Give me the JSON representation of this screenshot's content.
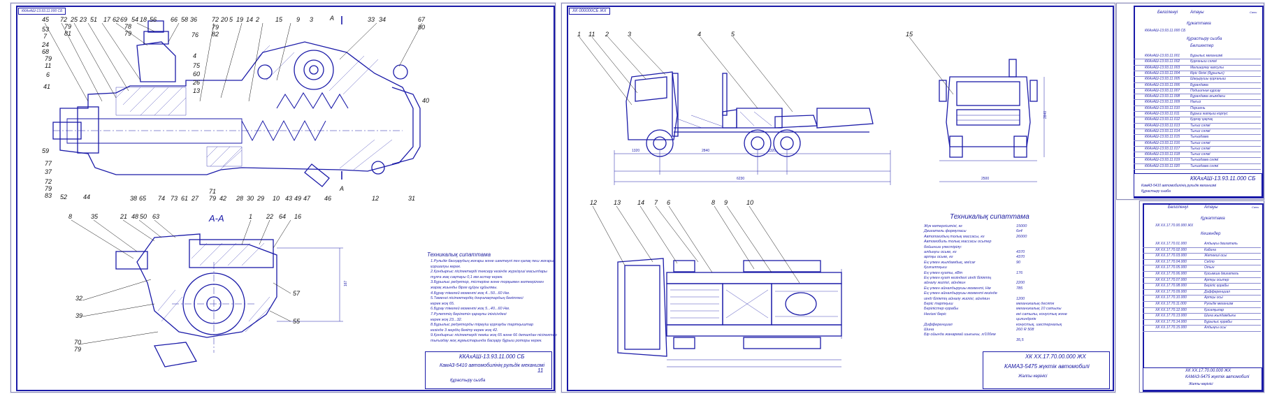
{
  "sheet1": {
    "tag": "ККАхАШ-13.93.11.000 СБ",
    "section_label": "А-А",
    "section_mark": "А",
    "callouts_top": [
      "45",
      "72",
      "25",
      "23",
      "51",
      "17",
      "62",
      "69",
      "54",
      "18",
      "56",
      "66",
      "58",
      "36",
      "72",
      "20",
      "5",
      "19",
      "14",
      "2",
      "15",
      "9",
      "3",
      "33",
      "34",
      "67",
      "80"
    ],
    "callouts_left": [
      "53",
      "7",
      "24",
      "68",
      "79",
      "11",
      "6",
      "41",
      "59",
      "77",
      "37",
      "72",
      "79",
      "83",
      "52",
      "44"
    ],
    "callouts_bottom": [
      "38",
      "65",
      "74",
      "73",
      "61",
      "27",
      "71",
      "79",
      "42",
      "28",
      "30",
      "29",
      "10",
      "43",
      "49",
      "47",
      "46",
      "12",
      "31"
    ],
    "callouts_right_top": [
      "76",
      "4",
      "75",
      "60",
      "26",
      "13",
      "79",
      "82",
      "40"
    ],
    "callouts_aa": [
      "8",
      "35",
      "21",
      "48",
      "50",
      "63",
      "1",
      "22",
      "64",
      "16",
      "32",
      "39",
      "70",
      "79",
      "57",
      "55"
    ],
    "notes_title": "Техникалық сипаттама",
    "notes": [
      "1.Рульдік басқарудың жоғары және шектеулі пен қалақ пеш жоғары",
      "  қоршалуы керек.",
      "2.Қондырғыс пісіпектерді тексеру кезінде жүргізуші масылдары",
      "  тұлға жақ сақтауы 0,1 мм астау керек.",
      "3.Бұрылыс редуктор, тістеріне және торқымен жеткерілген",
      "  жарақ жиынды бірге құйуы құйылмы.",
      "4.Бұрау тікелей моменті жоқ 4...50...60 Нм.",
      "5.Төменгі пісіпектердің доңғалақтардың бекітпесі",
      "  керек жоқ 65.",
      "6.Бұрау тікелей моменті жоқ 5...40...60 Нм.",
      "7.Рулеттің берілетін қараулы ілінісіндегі",
      "  керек жоқ 23...32.",
      "8.Бұрылыс редукторды тіреуіш қорғауды тартқыштар",
      "  кезінде 3 жердің бекіту керек жоқ 42.",
      "9.Қондырғыс пісіпектерді пеміш жоқ 65 және 66 деталдан пісіпектер",
      "  тығыздау жоқ жұмыстарында басқару бұрыш роторы керек."
    ],
    "stamp_code": "ККАхАШ-13.93.11.000 СБ",
    "stamp_title": "КамАЗ-5410 автомобилінің рульдік механизмі",
    "stamp_sub": "Құрастыру сызба",
    "stamp_sheet": "11"
  },
  "sheet2": {
    "tag": "ХК 000000СБ ЖХ",
    "callouts_side": [
      "1",
      "11",
      "2",
      "3",
      "4",
      "5"
    ],
    "callouts_front": [
      "15"
    ],
    "callouts_bottom_view": [
      "12",
      "13",
      "14",
      "7",
      "6",
      "8",
      "9",
      "10"
    ],
    "specs_title": "Техникалық сипаттама",
    "specs": [
      [
        "Жүк көтергіштігі, кг",
        "15000"
      ],
      [
        "Двигатель формуласы",
        "6х4"
      ],
      [
        "Автопоездың толық массасы, кг",
        "26000"
      ],
      [
        "Автомобиль толық массасы осьтер",
        ""
      ],
      [
        "бойынша үлестірілу:",
        ""
      ],
      [
        "алдыңғы оське, кг",
        "4370"
      ],
      [
        "артқы оське, кг",
        "4370"
      ],
      [
        "Ең үлкен жылдамдық, км/сағ",
        "90"
      ],
      [
        "Қозғалтқыш",
        ""
      ],
      [
        "Ең үлкен қуаты, кВт",
        "176"
      ],
      [
        "Ең үлкен қуат кезіндегі иінді біліктің",
        ""
      ],
      [
        "айналу жиілігі, айн/мин",
        "2200"
      ],
      [
        "Ең үлкен айналдырушы моменті, Нм",
        "785"
      ],
      [
        "Ең үлкен айналдырушы моменті кезінде",
        ""
      ],
      [
        "иінді біліктің айналу жиілігі, айн/мин",
        "1200"
      ],
      [
        "Беріс тартқыш",
        "механикалық десятк"
      ],
      [
        "Берілістер қорабы",
        "механикалық 10 сатылы"
      ],
      [
        "Негізгі беріс",
        "екі сатылы, конустық және"
      ],
      [
        "",
        "цилиндрлік"
      ],
      [
        "Дифференциал",
        "конустық, шестерналық"
      ],
      [
        "Шина",
        "260 R 508"
      ],
      [
        "Бір ойында жанармай шығыны, л/100км",
        ""
      ],
      [
        "",
        "35,5"
      ]
    ],
    "stamp_code": "ХК ХХ.17.70.00.000 ЖХ",
    "stamp_title": "КАМАЗ-5475 жүктік автомобилі",
    "stamp_sub": "Жалпы көрінісі"
  },
  "sheet3": {
    "head_cols": [
      "Белгіленуі",
      "Атауы",
      "Саны"
    ],
    "group_doc": "Құжаттама",
    "group_asm": "Құрастыру сызба",
    "group_parts": "Бөлшектер",
    "doc_row": "ККАхАШ-13.93.11.000 СБ",
    "rows": [
      [
        "ККАхАШ-13.93.11.001",
        "Бұрылыс механизмі"
      ],
      [
        "ККАхАШ-13.93.11.002",
        "Қорғаныш сәлмі"
      ],
      [
        "ККАхАШ-13.93.11.003",
        "Мөлшерлеу капсулы"
      ],
      [
        "ККАхАШ-13.93.11.004",
        "Кіріс білігі (бұрылыс)"
      ],
      [
        "ККАхАШ-13.93.11.005",
        "Шақырушы қорғаныш"
      ],
      [
        "ККАхАШ-13.93.11.006",
        "Бұрандама"
      ],
      [
        "ККАхАШ-13.93.11.007",
        "Подшипник құрсау"
      ],
      [
        "ККАхАШ-13.93.11.008",
        "Бұрандама ағымдағы"
      ],
      [
        "ККАхАШ-13.93.11.009",
        "Нығыз"
      ],
      [
        "ККАхАШ-13.93.11.010",
        "Поршень"
      ],
      [
        "ККАхАШ-13.93.11.011",
        "Бұрыш жапқыш корпус"
      ],
      [
        "ККАхАШ-13.93.11.012",
        "Қорғау қақпақ"
      ],
      [
        "ККАхАШ-13.93.11.013",
        "Тығыз сәлмі"
      ],
      [
        "ККАхАШ-13.93.11.014",
        "Тығыз сәлмі"
      ],
      [
        "ККАхАШ-13.93.11.015",
        "Тығыздама"
      ],
      [
        "ККАхАШ-13.93.11.016",
        "Тығыз сәлмі"
      ],
      [
        "ККАхАШ-13.93.11.017",
        "Тығыз сәлмі"
      ],
      [
        "ККАхАШ-13.93.11.018",
        "Тығыз сәлмі"
      ],
      [
        "ККАхАШ-13.93.11.019",
        "Тығыздама сәлмі"
      ],
      [
        "ККАхАШ-13.93.11.020",
        "Тығыздама сәлмі"
      ]
    ],
    "stamp_code": "ККАхАШ-13.93.11.000 СБ",
    "stamp_title": "КамАЗ-5410 автомобилінің рульдік механизмі",
    "stamp_sub": "Құрастыру сызба"
  },
  "sheet4": {
    "head_cols": [
      "Белгіленуі",
      "Атауы",
      "Саны"
    ],
    "group_doc": "Құжаттама",
    "group_asm": "Кешендер",
    "doc_row": "ХК ХХ.17.70.00.000 ЖХ",
    "rows": [
      [
        "ХК ХХ.17.70.01.000",
        "Алдыңғы двигатель"
      ],
      [
        "ХК ХХ.17.70.02.000",
        "Кабина"
      ],
      [
        "ХК ХХ.17.70.03.000",
        "Жетекші осьі"
      ],
      [
        "ХК ХХ.17.70.04.000",
        "Седло"
      ],
      [
        "ХК ХХ.17.70.05.000",
        "Отын"
      ],
      [
        "ХК ХХ.17.70.06.000",
        "Қосымша двигатель"
      ],
      [
        "ХК ХХ.17.70.07.000",
        "Артқы осьтер"
      ],
      [
        "ХК ХХ.17.70.08.000",
        "Беріліс қорабы"
      ],
      [
        "ХК ХХ.17.70.09.000",
        "Дифференциал"
      ],
      [
        "ХК ХХ.17.70.10.000",
        "Артқы осьі"
      ],
      [
        "ХК ХХ.17.70.11.000",
        "Рульдік механизм"
      ],
      [
        "ХК ХХ.17.70.12.000",
        "Қосалқылар"
      ],
      [
        "ХК ХХ.17.70.13.000",
        "Шина жылдамдығы"
      ],
      [
        "ХК ХХ.17.70.14.000",
        "Бұрылыс қорабы"
      ],
      [
        "ХК ХХ.17.70.15.000",
        "Алдыңғы осьі"
      ]
    ],
    "stamp_code": "ХК ХХ.17.70.00.000 ЖХ",
    "stamp_title": "КАМАЗ-5475 жүктік автомобилі",
    "stamp_sub": "Жалпы көрінісі"
  }
}
